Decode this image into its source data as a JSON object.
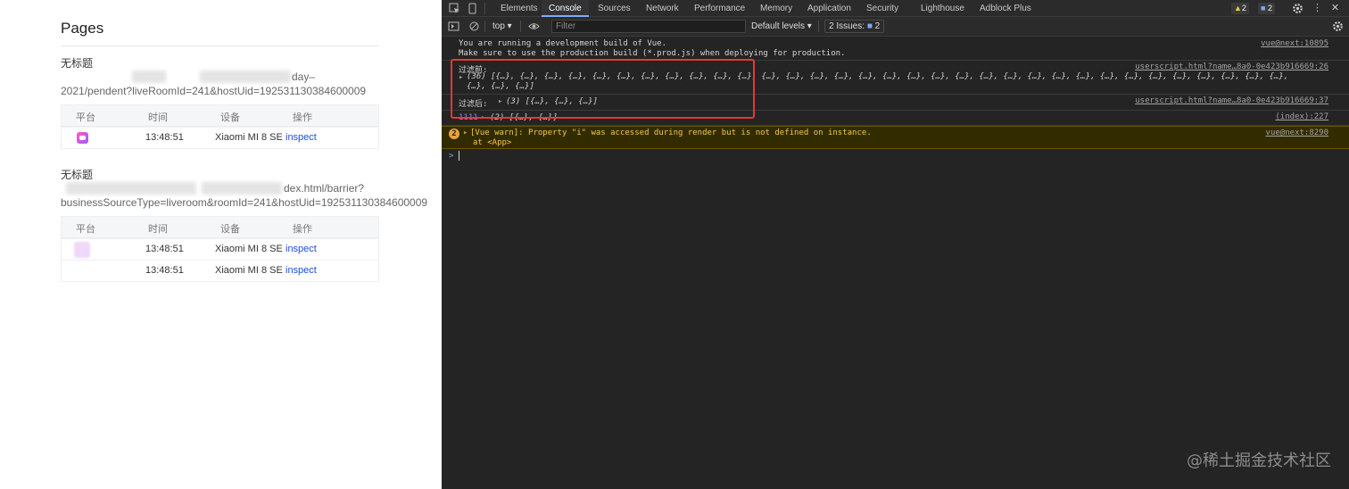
{
  "left": {
    "title": "Pages",
    "sections": [
      {
        "title": "无标题",
        "url_tail_1": "day–",
        "url_line_2": "2021/pendent?liveRoomId=241&hostUid=192531130384600009",
        "headers": [
          "平台",
          "时间",
          "设备",
          "操作"
        ],
        "rows": [
          {
            "time": "13:48:51",
            "device": "Xiaomi MI 8 SE",
            "action": "inspect"
          }
        ]
      },
      {
        "title": "无标题",
        "url_tail_1": "dex.html/barrier?",
        "url_line_2": "businessSourceType=liveroom&roomId=241&hostUid=192531130384600009",
        "headers": [
          "平台",
          "时间",
          "设备",
          "操作"
        ],
        "rows": [
          {
            "time": "13:48:51",
            "device": "Xiaomi MI 8 SE",
            "action": "inspect"
          },
          {
            "time": "13:48:51",
            "device": "Xiaomi MI 8 SE",
            "action": "inspect"
          }
        ]
      }
    ]
  },
  "devtools": {
    "tabs": [
      "Elements",
      "Console",
      "Sources",
      "Network",
      "Performance",
      "Memory",
      "Application",
      "Security",
      "Lighthouse",
      "Adblock Plus"
    ],
    "warn_count": "2",
    "info_count": "2",
    "context": "top",
    "filter_placeholder": "Filter",
    "levels": "Default levels",
    "issues_label": "2 Issues:",
    "issues_count": "2",
    "console": {
      "msg1_line1": "You are running a development build of Vue.",
      "msg1_line2": "Make sure to use the production build (*.prod.js) when deploying for production.",
      "msg1_src": "vue@next:10895",
      "before_label": "过滤前:",
      "before_src": "userscript.html?name…8a0-0e423b916669:26",
      "before_arr_line1": "(36) [{…}, {…}, {…}, {…}, {…}, {…}, {…}, {…}, {…}, {…}, {…}, {…}, {…}, {…}, {…}, {…}, {…}, {…}, {…}, {…}, {…}, {…}, {…}, {…}, {…}, {…}, {…}, {…}, {…}, {…}, {…}, {…}, {…},",
      "before_arr_line2": "{…}, {…}, {…}]",
      "after_label": "过滤后:",
      "after_arr": "(3) [{…}, {…}, {…}]",
      "after_src": "userscript.html?name…8a0-0e423b916669:37",
      "log_1111": "1111",
      "log_1111_arr": "(2) [{…}, {…}]",
      "log_1111_src": "(index):227",
      "warn_count": "2",
      "warn_line1": "[Vue warn]: Property \"i\" was accessed during render but is not defined on instance.",
      "warn_line2": "at <App>",
      "warn_src": "vue@next:8290",
      "prompt": ">"
    }
  },
  "watermark": "@稀土掘金技术社区",
  "colors": {
    "accent_blue": "#7cacf8",
    "highlight_red": "#e53935",
    "warn_yellow": "#f2c94c",
    "link_blue": "#1a4fd8"
  }
}
